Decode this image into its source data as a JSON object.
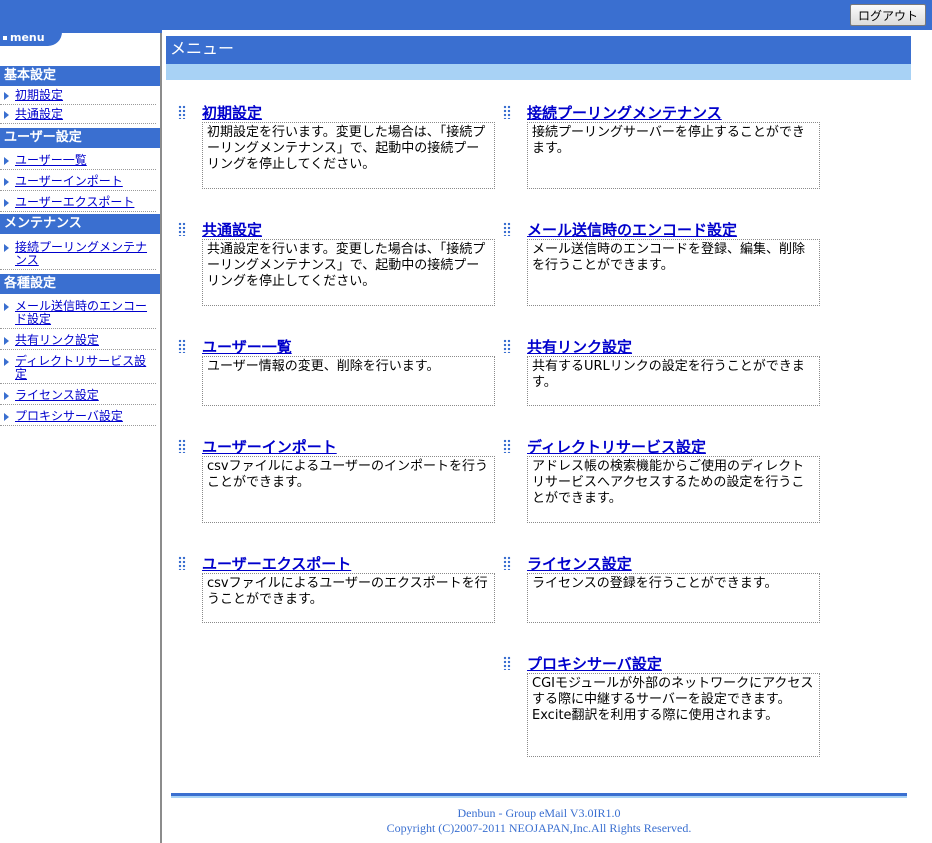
{
  "header": {
    "logout_label": "ログアウト"
  },
  "sidebar": {
    "menu_label": "menu",
    "groups": [
      {
        "title": "基本設定",
        "items": [
          "初期設定",
          "共通設定"
        ]
      },
      {
        "title": "ユーザー設定",
        "items": [
          "ユーザー一覧",
          "ユーザーインポート",
          "ユーザーエクスポート"
        ]
      },
      {
        "title": "メンテナンス",
        "items": [
          "接続プーリングメンテナンス"
        ]
      },
      {
        "title": "各種設定",
        "items": [
          "メール送信時のエンコード設定",
          "共有リンク設定",
          "ディレクトリサービス設定",
          "ライセンス設定",
          "プロキシサーバ設定"
        ]
      }
    ]
  },
  "main": {
    "title": "メニュー",
    "left": [
      {
        "title": "初期設定",
        "desc": "初期設定を行います。変更した場合は、「接続プーリングメンテナンス」で、起動中の接続プーリングを停止してください。"
      },
      {
        "title": "共通設定",
        "desc": "共通設定を行います。変更した場合は、「接続プーリングメンテナンス」で、起動中の接続プーリングを停止してください。"
      },
      {
        "title": "ユーザー一覧",
        "desc": "ユーザー情報の変更、削除を行います。"
      },
      {
        "title": "ユーザーインポート",
        "desc": "csvファイルによるユーザーのインポートを行うことができます。"
      },
      {
        "title": "ユーザーエクスポート",
        "desc": "csvファイルによるユーザーのエクスポートを行うことができます。"
      }
    ],
    "right": [
      {
        "title": "接続プーリングメンテナンス",
        "desc": "接続プーリングサーバーを停止することができます。"
      },
      {
        "title": "メール送信時のエンコード設定",
        "desc": "メール送信時のエンコードを登録、編集、削除を行うことができます。"
      },
      {
        "title": "共有リンク設定",
        "desc": "共有するURLリンクの設定を行うことができます。"
      },
      {
        "title": "ディレクトリサービス設定",
        "desc": "アドレス帳の検索機能からご使用のディレクトリサービスへアクセスするための設定を行うことができます。"
      },
      {
        "title": "ライセンス設定",
        "desc": "ライセンスの登録を行うことができます。"
      },
      {
        "title": "プロキシサーバ設定",
        "desc": "CGIモジュールが外部のネットワークにアクセスする際に中継するサーバーを設定できます。",
        "desc2": "Excite翻訳を利用する際に使用されます。"
      }
    ]
  },
  "footer": {
    "line1": "Denbun - Group eMail V3.0IR1.0",
    "line2": "Copyright (C)2007-2011 NEOJAPAN,Inc.All Rights Reserved."
  },
  "colors": {
    "primary": "#3a6fd0",
    "light": "#a8d2f5",
    "link": "#0000cc"
  }
}
